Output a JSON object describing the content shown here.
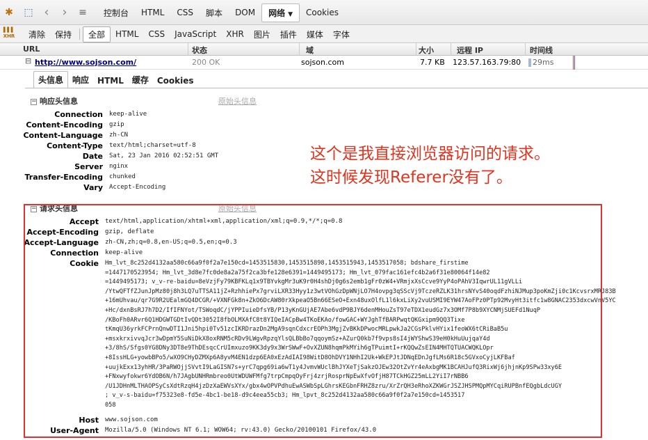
{
  "toolbar": {
    "tabs": [
      "控制台",
      "HTML",
      "CSS",
      "脚本",
      "DOM",
      "网络",
      "Cookies"
    ],
    "active_tab": "网络"
  },
  "filters": {
    "clear": "清除",
    "persist": "保持",
    "items": [
      "全部",
      "HTML",
      "CSS",
      "JavaScript",
      "XHR",
      "图片",
      "插件",
      "媒体",
      "字体"
    ],
    "active": "全部"
  },
  "columns": {
    "url": "URL",
    "status": "状态",
    "domain": "域",
    "size": "大小",
    "remote_ip": "远程 IP",
    "timeline": "时间线"
  },
  "request": {
    "url": "http://www.sojson.com/",
    "status": "200 OK",
    "domain": "sojson.com",
    "size": "7.7 KB",
    "remote_ip": "123.57.163.79:80",
    "time": "29ms"
  },
  "detail_tabs": [
    "头信息",
    "响应",
    "HTML",
    "缓存",
    "Cookies"
  ],
  "response_headers": {
    "title": "响应头信息",
    "view_source": "原始头信息",
    "rows": [
      {
        "name": "Connection",
        "value": "keep-alive"
      },
      {
        "name": "Content-Encoding",
        "value": "gzip"
      },
      {
        "name": "Content-Language",
        "value": "zh-CN"
      },
      {
        "name": "Content-Type",
        "value": "text/html;charset=utf-8"
      },
      {
        "name": "Date",
        "value": "Sat, 23 Jan 2016 02:52:51 GMT"
      },
      {
        "name": "Server",
        "value": "nginx"
      },
      {
        "name": "Transfer-Encoding",
        "value": "chunked"
      },
      {
        "name": "Vary",
        "value": "Accept-Encoding"
      }
    ]
  },
  "request_headers": {
    "title": "请求头信息",
    "view_source": "原始头信息",
    "rows_before_cookie": [
      {
        "name": "Accept",
        "value": "text/html,application/xhtml+xml,application/xml;q=0.9,*/*;q=0.8"
      },
      {
        "name": "Accept-Encoding",
        "value": "gzip, deflate"
      },
      {
        "name": "Accept-Language",
        "value": "zh-CN,zh;q=0.8,en-US;q=0.5,en;q=0.3"
      },
      {
        "name": "Connection",
        "value": "keep-alive"
      }
    ],
    "cookie_name": "Cookie",
    "cookie_lines": [
      "Hm_lvt_8c252d4132aa580c66a9f0f2a7e150cd=1453515830,1453515898,1453515943,1453517058; bdshare_firstime",
      "=1447170523954; Hm_lvt_3d8e7fc0de8a2a75f2ca3bfe128e6391=1449495173; Hm_lvt_079fac161efc4b2a6f31e80064f14e82",
      "=1449495173; v_v-re-baidu=8eVzjFy79KBFKLq1x9TBYvkgMr3uK9r0H4shDj0g6s2emb1gFr0zW4+VRmjxXsCcve9YyP4oPAhV3IqwrUL11gVLLi",
      "/YtwQFTfZJunJpMz80j8h3LQ7uTTSA11jZ+RzhhiePx7grviLXR33Hyy1z3wtVOhGzDpWNjLO7H4ovpg3qSScVj9TczeRZLK31hrsNYvS40oqdFzhiNJMup3poKmZji0c1KcvsrxMRJ83B",
      "+16mUhvau/qr7G9R2UEalmGQ4DCGR/+VXNFGk8n+ZkO6DcAW80rXkpeaO5Bn66ESeO+Exn48uxOlfL1l6kxLiXy2vuUSMI9EYW47AoFPz0PTp92MvyHt3itfc1w8GNAC2353dxcwVnV5YC",
      "+Hc/dxnBsRJ7h7D2/IfIFNYot/TSWoqdC/jYPPIuieDfsYB/P13yKnGUjAE7Abe6vdP9BJY6denMHouZsT97eTDX1eudGz7x3OMf7P8b9XYCNMjSUEFd1NuqP",
      "/KBoFh0ARvr6Q1HDGWTGDtIvQDt3052I8fbOLMXAfC8t8YIQeIACpBw4TKoEKAo/fowGAC+WYJghTfBARPwqtQKGxipm9QQ3Tixe",
      "tKmqU36yrkFCPrnQnwDTI1Jni5hpi0Tv51zcIKRDrazDn2MgA9sqnCdxcrEOPh3MgjZvBKkDPwocMRLpwkJa2CGsPklvHYix1feoWX6tCRiBaB5u",
      "+msxkrxivvqJcr3wDpmY5SuNiDkX8oxRNM5cRDv9LWgvRpzqYlsQLBbBo7qqoymSz+AZurQ0kb7f9vps8sI4jWYShwS39eH0kHuUujqaY4d",
      "+3/8hS/Sfgs0YG8DNy3DT8e9ThDEsqcCrUImxuzo9KK3dy9x3WrSWwF+OvXZUN8hqmPkMYih6gTPuimtI+rKQQwZsEIN4MHTQTUACWQKLOpr",
      "+8IssHLG+yowbBPo5/wXO9CHyDZMXp6A8yvM4EN1dzp6EA0xEzAdIAI98WitD8OhDVY1NHhI2Uk+WkEPJtJDNqEDnJgfLMs6R18c5GVxoCyjLKFBaf",
      "+uujkExx13yhHR/3PaRWOjjSVvtI9LaGISN7s+yrC7qpg69ia6wT1y4JvmvWUclBhJYXeTjSakzOJEw32OtZvYr4eAxbgMK1BCAHJufQ3RixWj6jhjnKp9SPw33xy6E",
      "+FNxwyfokwr6YdOB6N/h7JAgbUNHRmbreo0UtWDUWFMfg7trpCmpqOyFrj4zrjRosprNpEwXfvOfjH87TCkHGZ25mLL2YiI7rNBB6",
      "/U1JDHnMLTHAOPSyCsXdtRzqH4jzDzXaEWVsXYx/gbx4wOPVPdhuEwASWbSpLGhrsKEGbnFRHZ8zru/XrZrQH3eRhoXZKWGrJSZJHSPMQpMYCqiRUPBnfEQgbLdcUGY",
      "; v_v-s-baidu=f75323e8-fd5e-4bc1-be18-d9c4eea55cb3; Hm_lpvt_8c252d4132aa580c66a9f0f2a7e150cd=1453517",
      "058"
    ],
    "rows_after_cookie": [
      {
        "name": "Host",
        "value": "www.sojson.com"
      },
      {
        "name": "User-Agent",
        "value": "Mozilla/5.0 (Windows NT 6.1; WOW64; rv:43.0) Gecko/20100101 Firefox/43.0"
      }
    ]
  },
  "annotation": {
    "line1": "这个是我直接浏览器访问的请求。",
    "line2": "这时候发现Referer没有了。",
    "color": "#e2331f"
  }
}
